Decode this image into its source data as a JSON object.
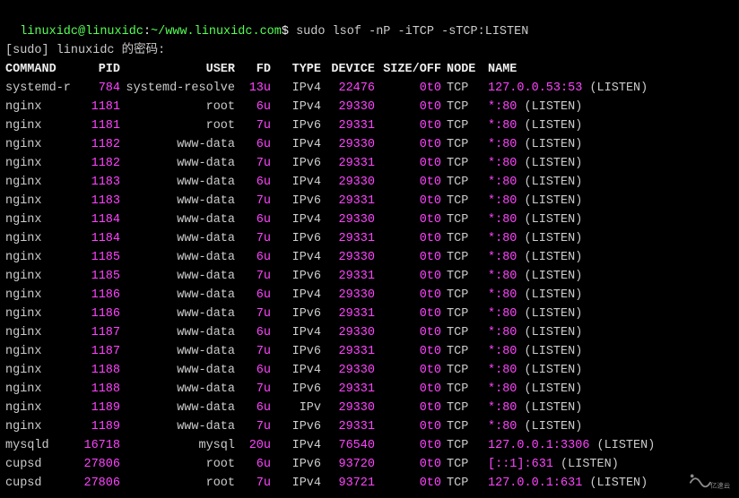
{
  "prompt": {
    "user_host": "linuxidc@linuxidc",
    "sep1": ":",
    "cwd": "~/www.linuxidc.com",
    "sep2": "$ ",
    "command": "sudo lsof -nP -iTCP -sTCP:LISTEN"
  },
  "sudo_prompt": "[sudo] linuxidc 的密码:",
  "headers": {
    "command": "COMMAND",
    "pid": "PID",
    "user": "USER",
    "fd": "FD",
    "type": "TYPE",
    "device": "DEVICE",
    "size": "SIZE/OFF",
    "node": "NODE",
    "name": "NAME"
  },
  "rows": [
    {
      "command": "systemd-r",
      "pid": "784",
      "user": "systemd-resolve",
      "fd": "13u",
      "type": "IPv4",
      "device": "22476",
      "size": "0t0",
      "node": "TCP",
      "name": "127.0.0.53:53",
      "state": "(LISTEN)"
    },
    {
      "command": "nginx",
      "pid": "1181",
      "user": "root",
      "fd": "6u",
      "type": "IPv4",
      "device": "29330",
      "size": "0t0",
      "node": "TCP",
      "name": "*:80",
      "state": "(LISTEN)"
    },
    {
      "command": "nginx",
      "pid": "1181",
      "user": "root",
      "fd": "7u",
      "type": "IPv6",
      "device": "29331",
      "size": "0t0",
      "node": "TCP",
      "name": "*:80",
      "state": "(LISTEN)"
    },
    {
      "command": "nginx",
      "pid": "1182",
      "user": "www-data",
      "fd": "6u",
      "type": "IPv4",
      "device": "29330",
      "size": "0t0",
      "node": "TCP",
      "name": "*:80",
      "state": "(LISTEN)"
    },
    {
      "command": "nginx",
      "pid": "1182",
      "user": "www-data",
      "fd": "7u",
      "type": "IPv6",
      "device": "29331",
      "size": "0t0",
      "node": "TCP",
      "name": "*:80",
      "state": "(LISTEN)"
    },
    {
      "command": "nginx",
      "pid": "1183",
      "user": "www-data",
      "fd": "6u",
      "type": "IPv4",
      "device": "29330",
      "size": "0t0",
      "node": "TCP",
      "name": "*:80",
      "state": "(LISTEN)"
    },
    {
      "command": "nginx",
      "pid": "1183",
      "user": "www-data",
      "fd": "7u",
      "type": "IPv6",
      "device": "29331",
      "size": "0t0",
      "node": "TCP",
      "name": "*:80",
      "state": "(LISTEN)"
    },
    {
      "command": "nginx",
      "pid": "1184",
      "user": "www-data",
      "fd": "6u",
      "type": "IPv4",
      "device": "29330",
      "size": "0t0",
      "node": "TCP",
      "name": "*:80",
      "state": "(LISTEN)"
    },
    {
      "command": "nginx",
      "pid": "1184",
      "user": "www-data",
      "fd": "7u",
      "type": "IPv6",
      "device": "29331",
      "size": "0t0",
      "node": "TCP",
      "name": "*:80",
      "state": "(LISTEN)"
    },
    {
      "command": "nginx",
      "pid": "1185",
      "user": "www-data",
      "fd": "6u",
      "type": "IPv4",
      "device": "29330",
      "size": "0t0",
      "node": "TCP",
      "name": "*:80",
      "state": "(LISTEN)"
    },
    {
      "command": "nginx",
      "pid": "1185",
      "user": "www-data",
      "fd": "7u",
      "type": "IPv6",
      "device": "29331",
      "size": "0t0",
      "node": "TCP",
      "name": "*:80",
      "state": "(LISTEN)"
    },
    {
      "command": "nginx",
      "pid": "1186",
      "user": "www-data",
      "fd": "6u",
      "type": "IPv4",
      "device": "29330",
      "size": "0t0",
      "node": "TCP",
      "name": "*:80",
      "state": "(LISTEN)"
    },
    {
      "command": "nginx",
      "pid": "1186",
      "user": "www-data",
      "fd": "7u",
      "type": "IPv6",
      "device": "29331",
      "size": "0t0",
      "node": "TCP",
      "name": "*:80",
      "state": "(LISTEN)"
    },
    {
      "command": "nginx",
      "pid": "1187",
      "user": "www-data",
      "fd": "6u",
      "type": "IPv4",
      "device": "29330",
      "size": "0t0",
      "node": "TCP",
      "name": "*:80",
      "state": "(LISTEN)"
    },
    {
      "command": "nginx",
      "pid": "1187",
      "user": "www-data",
      "fd": "7u",
      "type": "IPv6",
      "device": "29331",
      "size": "0t0",
      "node": "TCP",
      "name": "*:80",
      "state": "(LISTEN)"
    },
    {
      "command": "nginx",
      "pid": "1188",
      "user": "www-data",
      "fd": "6u",
      "type": "IPv4",
      "device": "29330",
      "size": "0t0",
      "node": "TCP",
      "name": "*:80",
      "state": "(LISTEN)"
    },
    {
      "command": "nginx",
      "pid": "1188",
      "user": "www-data",
      "fd": "7u",
      "type": "IPv6",
      "device": "29331",
      "size": "0t0",
      "node": "TCP",
      "name": "*:80",
      "state": "(LISTEN)"
    },
    {
      "command": "nginx",
      "pid": "1189",
      "user": "www-data",
      "fd": "6u",
      "type": "IPv",
      "device": "29330",
      "size": "0t0",
      "node": "TCP",
      "name": "*:80",
      "state": "(LISTEN)"
    },
    {
      "command": "nginx",
      "pid": "1189",
      "user": "www-data",
      "fd": "7u",
      "type": "IPv6",
      "device": "29331",
      "size": "0t0",
      "node": "TCP",
      "name": "*:80",
      "state": "(LISTEN)"
    },
    {
      "command": "mysqld",
      "pid": "16718",
      "user": "mysql",
      "fd": "20u",
      "type": "IPv4",
      "device": "76540",
      "size": "0t0",
      "node": "TCP",
      "name": "127.0.0.1:3306",
      "state": "(LISTEN)"
    },
    {
      "command": "cupsd",
      "pid": "27806",
      "user": "root",
      "fd": "6u",
      "type": "IPv6",
      "device": "93720",
      "size": "0t0",
      "node": "TCP",
      "name": "[::1]:631",
      "state": "(LISTEN)"
    },
    {
      "command": "cupsd",
      "pid": "27806",
      "user": "root",
      "fd": "7u",
      "type": "IPv4",
      "device": "93721",
      "size": "0t0",
      "node": "TCP",
      "name": "127.0.0.1:631",
      "state": "(LISTEN)"
    }
  ],
  "watermark_text": "亿速云"
}
